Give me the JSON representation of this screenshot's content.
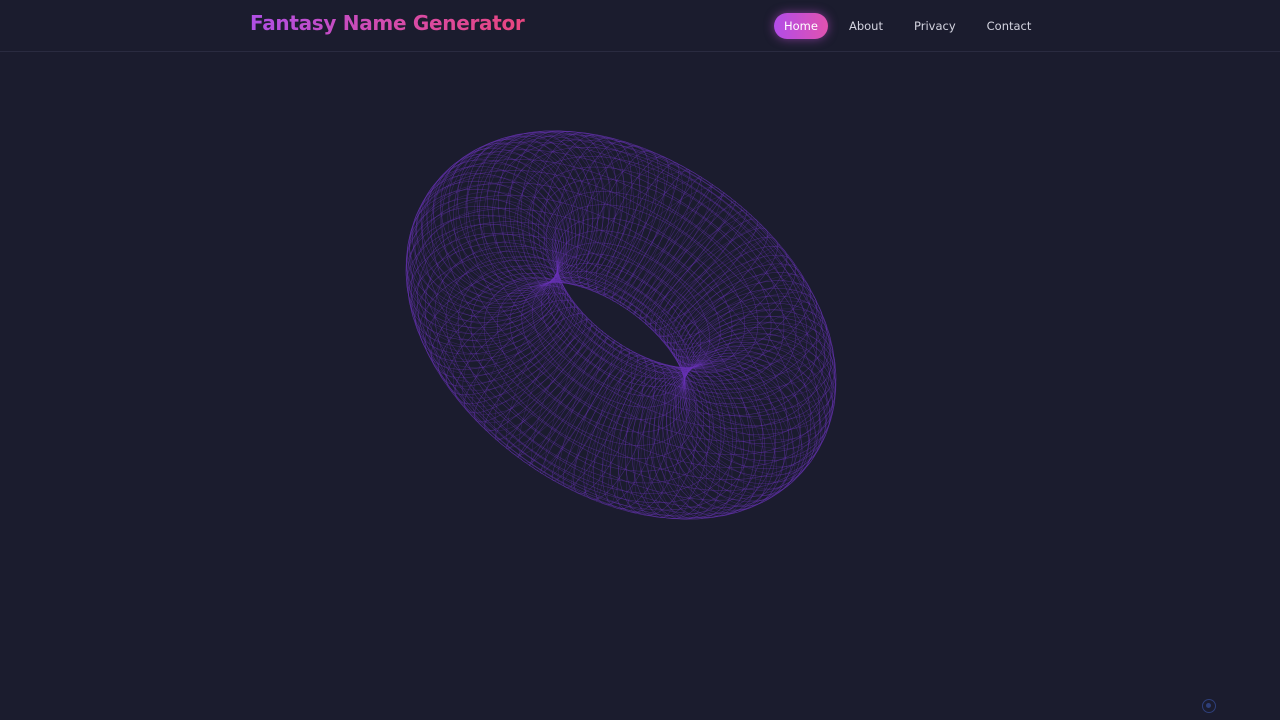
{
  "header": {
    "brand": "Fantasy Name Generator",
    "nav": [
      {
        "label": "Home",
        "active": true
      },
      {
        "label": "About",
        "active": false
      },
      {
        "label": "Privacy",
        "active": false
      },
      {
        "label": "Contact",
        "active": false
      }
    ]
  },
  "colors": {
    "background": "#1b1c2e",
    "accent_start": "#b24ce8",
    "accent_end": "#e052b0",
    "wireframe": "#6a35b8"
  },
  "visual": {
    "shape": "torus",
    "style": "wireframe"
  },
  "icons": {
    "corner": "badge-icon"
  }
}
